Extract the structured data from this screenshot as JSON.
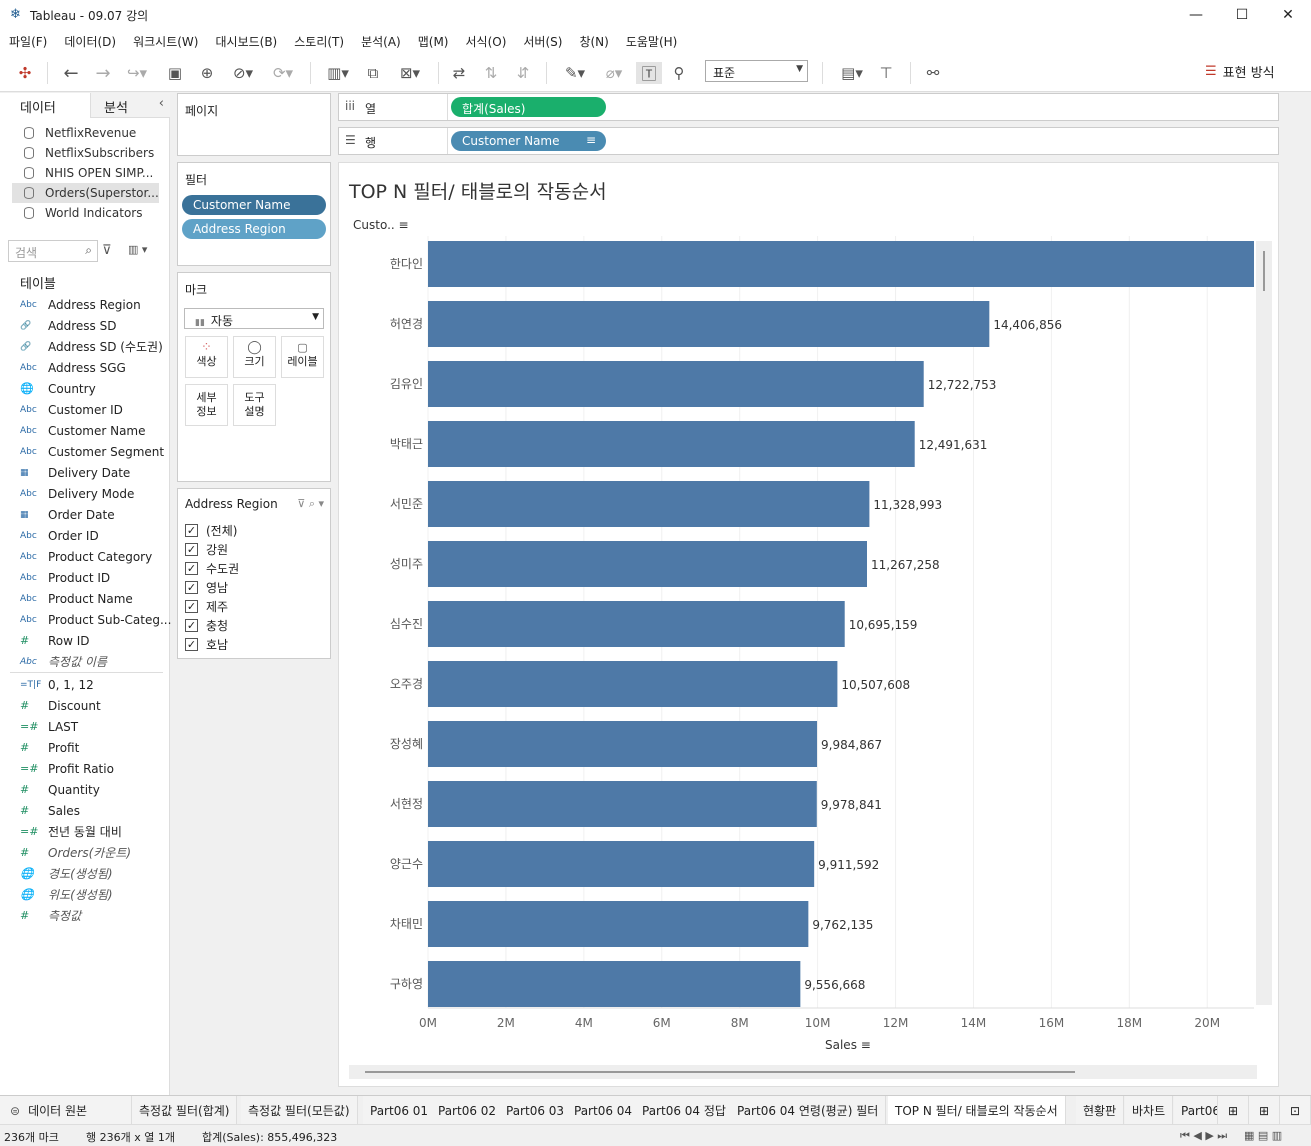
{
  "window": {
    "title": "Tableau - 09.07 강의",
    "min": "—",
    "max": "☐",
    "close": "✕"
  },
  "menu": [
    "파일(F)",
    "데이터(D)",
    "워크시트(W)",
    "대시보드(B)",
    "스토리(T)",
    "분석(A)",
    "맵(M)",
    "서식(O)",
    "서버(S)",
    "창(N)",
    "도움말(H)"
  ],
  "toolbar": {
    "fit": "표준",
    "show_me": "표현 방식"
  },
  "side": {
    "tab_data": "데이터",
    "tab_analysis": "분석",
    "search_placeholder": "검색",
    "tables_heading": "테이블"
  },
  "datasources": [
    "NetflixRevenue",
    "NetflixSubscribers",
    "NHIS OPEN SIMP...",
    "Orders(Superstor...",
    "World Indicators"
  ],
  "dimensions": [
    {
      "icon": "Abc",
      "name": "Address Region"
    },
    {
      "icon": "🔗",
      "name": "Address SD"
    },
    {
      "icon": "🔗",
      "name": "Address SD (수도권)"
    },
    {
      "icon": "Abc",
      "name": "Address SGG"
    },
    {
      "icon": "🌐",
      "name": "Country"
    },
    {
      "icon": "Abc",
      "name": "Customer ID"
    },
    {
      "icon": "Abc",
      "name": "Customer Name"
    },
    {
      "icon": "Abc",
      "name": "Customer Segment"
    },
    {
      "icon": "▦",
      "name": "Delivery Date"
    },
    {
      "icon": "Abc",
      "name": "Delivery Mode"
    },
    {
      "icon": "▦",
      "name": "Order Date"
    },
    {
      "icon": "Abc",
      "name": "Order ID"
    },
    {
      "icon": "Abc",
      "name": "Product Category"
    },
    {
      "icon": "Abc",
      "name": "Product ID"
    },
    {
      "icon": "Abc",
      "name": "Product Name"
    },
    {
      "icon": "Abc",
      "name": "Product Sub-Categ..."
    },
    {
      "icon": "#",
      "name": "Row ID"
    },
    {
      "icon": "Abc",
      "name": "측정값 이름",
      "italic": true
    }
  ],
  "measures": [
    {
      "icon": "=T|F",
      "name": "0, 1, 12"
    },
    {
      "icon": "#",
      "name": "Discount"
    },
    {
      "icon": "=#",
      "name": "LAST"
    },
    {
      "icon": "#",
      "name": "Profit"
    },
    {
      "icon": "=#",
      "name": "Profit Ratio"
    },
    {
      "icon": "#",
      "name": "Quantity"
    },
    {
      "icon": "#",
      "name": "Sales"
    },
    {
      "icon": "=#",
      "name": "전년 동월 대비"
    },
    {
      "icon": "#",
      "name": "Orders(카운트)",
      "italic": true
    },
    {
      "icon": "🌐",
      "name": "경도(생성됨)",
      "italic": true
    },
    {
      "icon": "🌐",
      "name": "위도(생성됨)",
      "italic": true
    },
    {
      "icon": "#",
      "name": "측정값",
      "italic": true
    }
  ],
  "pages_label": "페이지",
  "filters": {
    "label": "필터",
    "pills": [
      "Customer Name",
      "Address Region"
    ]
  },
  "marks": {
    "label": "마크",
    "type": "자동",
    "buttons": [
      "색상",
      "크기",
      "레이블",
      "세부\n정보",
      "도구\n설명"
    ]
  },
  "region_filter": {
    "title": "Address Region",
    "items": [
      "(전체)",
      "강원",
      "수도권",
      "영남",
      "제주",
      "충청",
      "호남"
    ]
  },
  "shelves": {
    "columns_label": "열",
    "columns_pill": "합계(Sales)",
    "rows_label": "행",
    "rows_pill": "Customer Name"
  },
  "view_title": "TOP N 필터/ 태블로의 작동순서",
  "chart_data": {
    "type": "bar",
    "orientation": "horizontal",
    "row_header": "Custo..",
    "xlabel": "Sales",
    "xlim": [
      0,
      21200000
    ],
    "ticks": [
      "0M",
      "2M",
      "4M",
      "6M",
      "8M",
      "10M",
      "12M",
      "14M",
      "16M",
      "18M",
      "20M"
    ],
    "tick_values": [
      0,
      2000000,
      4000000,
      6000000,
      8000000,
      10000000,
      12000000,
      14000000,
      16000000,
      18000000,
      20000000
    ],
    "color": "#4e79a7",
    "categories": [
      "한다인",
      "허연경",
      "김유인",
      "박태근",
      "서민준",
      "성미주",
      "심수진",
      "오주경",
      "장성혜",
      "서현정",
      "양근수",
      "차태민",
      "구하영"
    ],
    "values": [
      21300000,
      14406856,
      12722753,
      12491631,
      11328993,
      11267258,
      10695159,
      10507608,
      9984867,
      9978841,
      9911592,
      9762135,
      9556668
    ],
    "labels": [
      "",
      "14,406,856",
      "12,722,753",
      "12,491,631",
      "11,328,993",
      "11,267,258",
      "10,695,159",
      "10,507,608",
      "9,984,867",
      "9,978,841",
      "9,911,592",
      "9,762,135",
      "9,556,668"
    ]
  },
  "sheet_tabs": [
    "데이터 원본",
    "측정값 필터(합계)",
    "측정값 필터(모든값)",
    "Part06 01",
    "Part06 02",
    "Part06 03",
    "Part06 04",
    "Part06 04 정답",
    "Part06 04 연령(평균) 필터",
    "TOP N 필터/ 태블로의 작동순서",
    "현황판",
    "바차트",
    "Part06"
  ],
  "status": {
    "marks": "236개 마크",
    "rows_cols": "행 236개 x 열 1개",
    "sum": "합계(Sales): 855,496,323"
  }
}
